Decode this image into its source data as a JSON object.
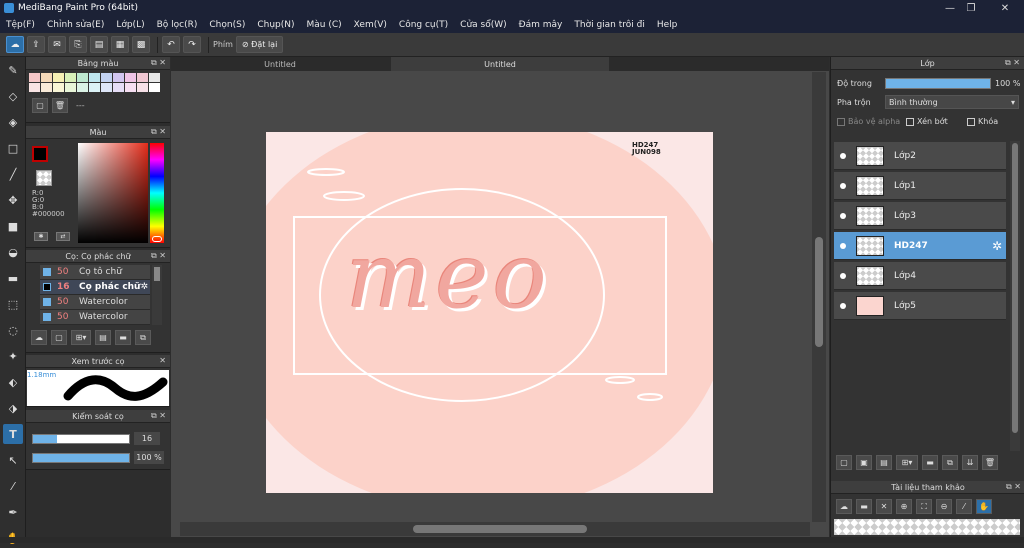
{
  "window": {
    "title": "MediBang Paint Pro (64bit)",
    "controls": [
      "—",
      "❐",
      "✕"
    ]
  },
  "menu": [
    "Tệp(F)",
    "Chỉnh sửa(E)",
    "Lớp(L)",
    "Bộ lọc(R)",
    "Chọn(S)",
    "Chụp(N)",
    "Màu (C)",
    "Xem(V)",
    "Công cụ(T)",
    "Cửa sổ(W)",
    "Đám mây",
    "Thời gian trôi đi",
    "Help"
  ],
  "toolbar": {
    "key_label": "Phím",
    "reset_label": "Đặt lại"
  },
  "color_palette": {
    "title": "Bảng màu",
    "swatches": [
      "#f6c8c8",
      "#f5d9b8",
      "#f6f0b4",
      "#d8f0b8",
      "#bde8cf",
      "#bfe7ef",
      "#c3d3f2",
      "#d2c6f0",
      "#efc4e6",
      "#f1c8d3",
      "#e8e8e8",
      "#f8e3e3",
      "#f9ead8",
      "#f9f6d6",
      "#e8f6d8",
      "#dbf3e6",
      "#dbf2f6",
      "#dde6f8",
      "#e6def7",
      "#f6dff2",
      "#f7e1e8",
      "#ffffff"
    ],
    "name_placeholder": "---"
  },
  "color": {
    "title": "Màu",
    "r": "R:0",
    "g": "G:0",
    "b": "B:0",
    "hex": "#000000",
    "primary": "#c00000"
  },
  "brush": {
    "title": "Cọ: Cọ phác chữ",
    "items": [
      {
        "size": "50",
        "name": "Cọ tô chữ",
        "selected": false
      },
      {
        "size": "16",
        "name": "Cọ phác chữ",
        "selected": true
      },
      {
        "size": "50",
        "name": "Watercolor",
        "selected": false
      },
      {
        "size": "50",
        "name": "Watercolor",
        "selected": false
      }
    ]
  },
  "brush_preview": {
    "title": "Xem trước cọ",
    "size_label": "1.18mm"
  },
  "brush_control": {
    "title": "Kiểm soát cọ",
    "size_value": "16",
    "size_fraction": 0.25,
    "opacity_value": "100 %",
    "opacity_fraction": 1.0
  },
  "tabs": [
    "Untitled",
    "Untitled"
  ],
  "canvas": {
    "text": "meo",
    "watermark_line1": "HD247",
    "watermark_line2": "JUN098"
  },
  "layers_panel": {
    "title": "Lớp",
    "opacity_label": "Độ trong",
    "opacity_value": "100 %",
    "opacity_fraction": 1.0,
    "blend_label": "Pha trộn",
    "blend_value": "Bình thường",
    "protect_alpha": "Bảo vệ alpha",
    "clip": "Xén bớt",
    "lock": "Khóa",
    "layers": [
      {
        "name": "Lớp2",
        "selected": false
      },
      {
        "name": "Lớp1",
        "selected": false
      },
      {
        "name": "Lớp3",
        "selected": false
      },
      {
        "name": "HD247",
        "selected": true
      },
      {
        "name": "Lớp4",
        "selected": false
      },
      {
        "name": "Lớp5",
        "selected": false
      }
    ]
  },
  "reference_panel": {
    "title": "Tài liệu tham khảo"
  }
}
